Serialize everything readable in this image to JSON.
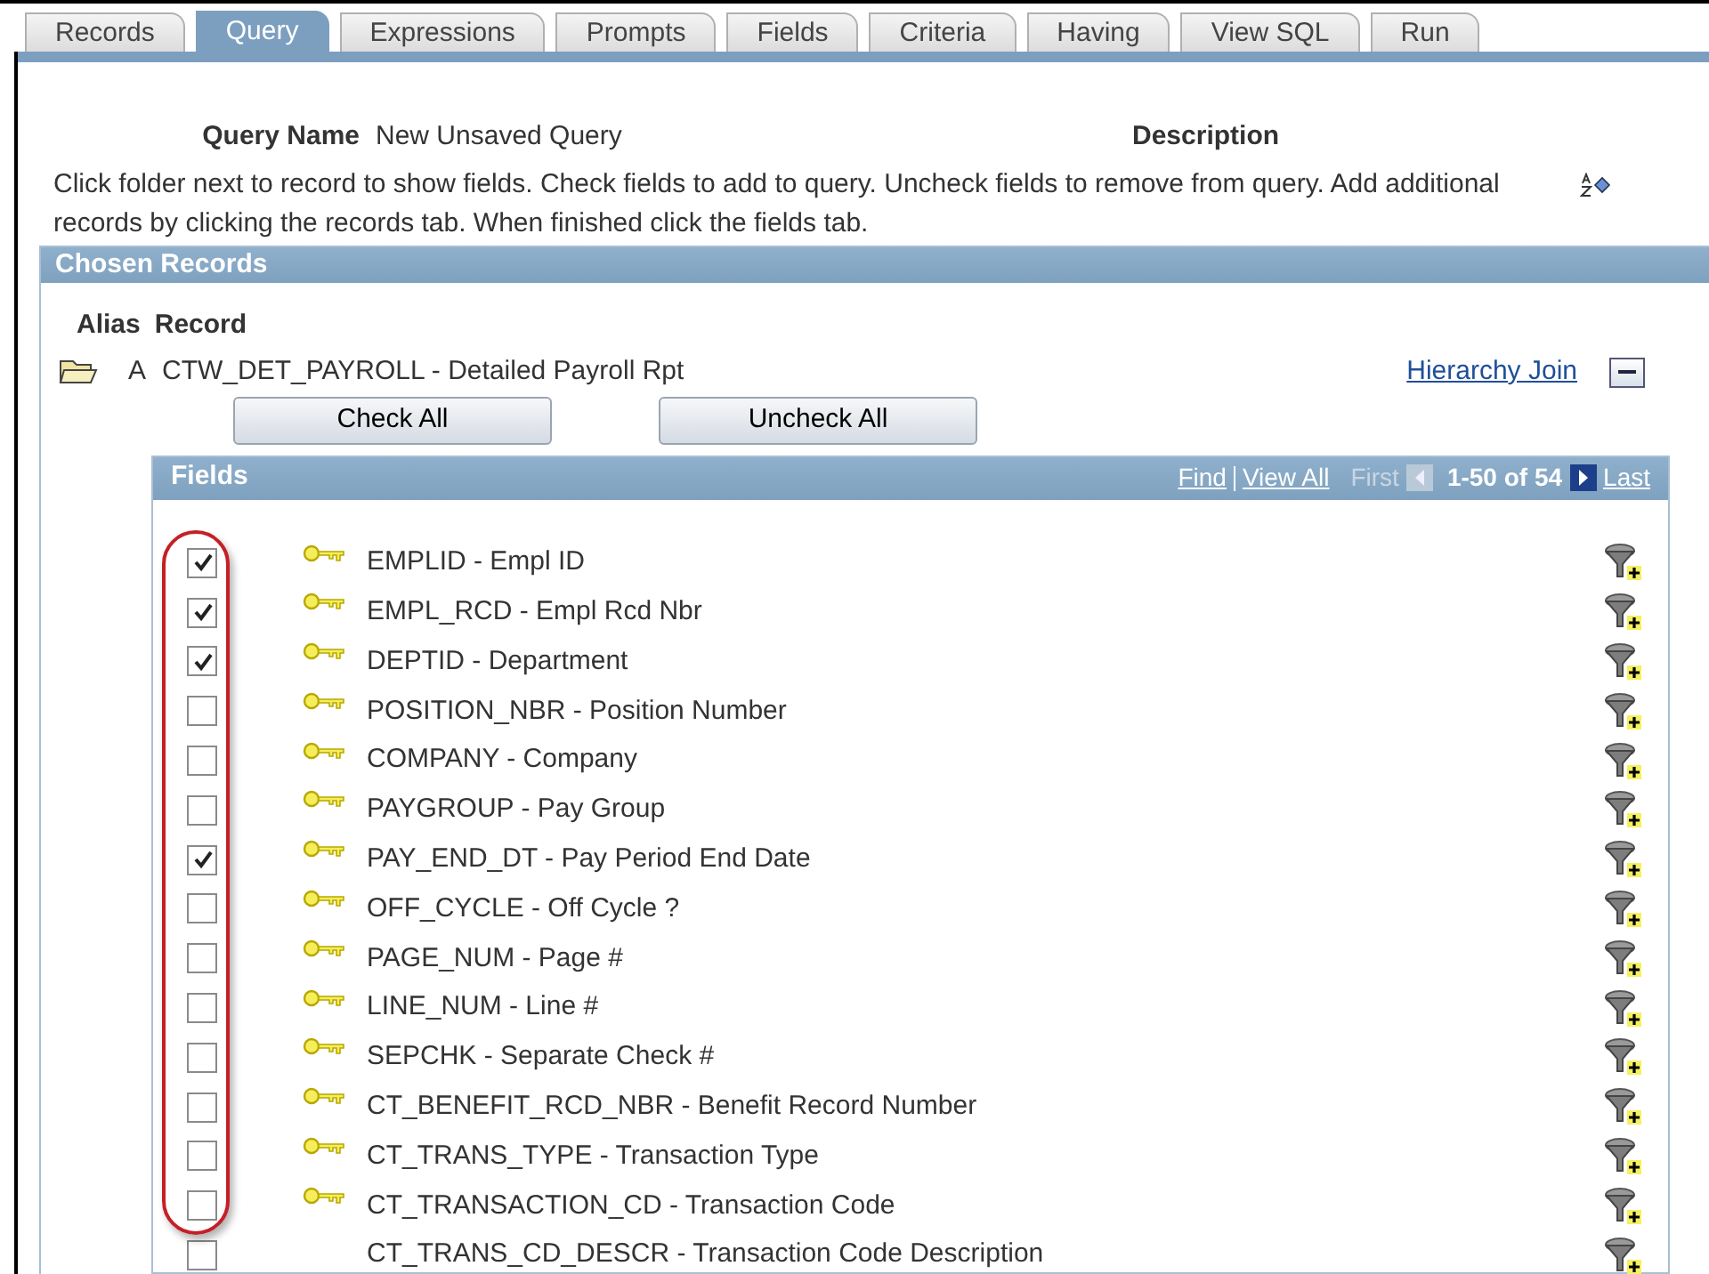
{
  "tabs": [
    {
      "label": "Records",
      "selected": false
    },
    {
      "label": "Query",
      "selected": true
    },
    {
      "label": "Expressions",
      "selected": false
    },
    {
      "label": "Prompts",
      "selected": false
    },
    {
      "label": "Fields",
      "selected": false
    },
    {
      "label": "Criteria",
      "selected": false
    },
    {
      "label": "Having",
      "selected": false
    },
    {
      "label": "View SQL",
      "selected": false
    },
    {
      "label": "Run",
      "selected": false
    }
  ],
  "query_name": {
    "label": "Query Name",
    "value": "New Unsaved Query"
  },
  "description": {
    "label": "Description"
  },
  "instructions": "Click folder next to record to show fields. Check fields to add to query. Uncheck fields to remove from query. Add additional records by clicking the records tab. When finished click the fields tab.",
  "chosen_records": {
    "title": "Chosen Records",
    "columns": [
      "Alias",
      "Record"
    ],
    "record": {
      "alias": "A",
      "name": "CTW_DET_PAYROLL - Detailed Payroll Rpt",
      "link": "Hierarchy Join"
    },
    "buttons": [
      "Check All",
      "Uncheck All"
    ],
    "fields_grid": {
      "title": "Fields",
      "find": "Find",
      "view_all": "View All",
      "first": "First",
      "range": "1-50 of 54",
      "last": "Last",
      "rows": [
        {
          "label": "EMPLID - Empl ID",
          "checked": true,
          "key": true
        },
        {
          "label": "EMPL_RCD - Empl Rcd Nbr",
          "checked": true,
          "key": true
        },
        {
          "label": "DEPTID - Department",
          "checked": true,
          "key": true
        },
        {
          "label": "POSITION_NBR - Position Number",
          "checked": false,
          "key": true
        },
        {
          "label": "COMPANY - Company",
          "checked": false,
          "key": true
        },
        {
          "label": "PAYGROUP - Pay Group",
          "checked": false,
          "key": true
        },
        {
          "label": "PAY_END_DT - Pay Period End Date",
          "checked": true,
          "key": true
        },
        {
          "label": "OFF_CYCLE - Off Cycle ?",
          "checked": false,
          "key": true
        },
        {
          "label": "PAGE_NUM - Page #",
          "checked": false,
          "key": true
        },
        {
          "label": "LINE_NUM - Line #",
          "checked": false,
          "key": true
        },
        {
          "label": "SEPCHK - Separate Check #",
          "checked": false,
          "key": true
        },
        {
          "label": "CT_BENEFIT_RCD_NBR - Benefit Record Number",
          "checked": false,
          "key": true
        },
        {
          "label": "CT_TRANS_TYPE - Transaction Type",
          "checked": false,
          "key": true
        },
        {
          "label": "CT_TRANSACTION_CD - Transaction Code",
          "checked": false,
          "key": true
        },
        {
          "label": "CT_TRANS_CD_DESCR - Transaction Code Description",
          "checked": false,
          "key": false
        }
      ]
    }
  }
}
